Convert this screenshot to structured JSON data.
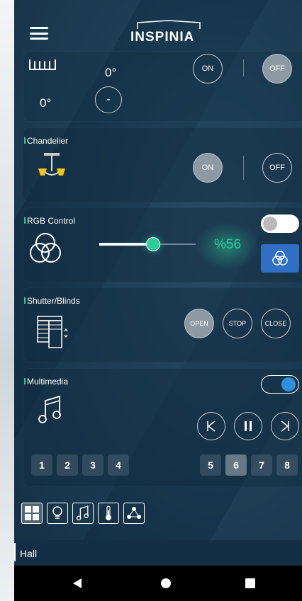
{
  "header": {
    "app_name": "INSPINIA"
  },
  "heating": {
    "setpoint": "0°",
    "current": "0°",
    "minus_label": "-",
    "on_label": "ON",
    "off_label": "OFF"
  },
  "chandelier": {
    "title": "Chandelier",
    "on_label": "ON",
    "off_label": "OFF"
  },
  "rgb": {
    "title": "RGB Control",
    "level_text": "%56",
    "slider_value_percent": 56
  },
  "shutter": {
    "title": "Shutter/Blinds",
    "open_label": "OPEN",
    "stop_label": "STOP",
    "close_label": "CLOSE"
  },
  "multimedia": {
    "title": "Multimedia",
    "numbers": [
      "1",
      "2",
      "3",
      "4",
      "5",
      "6",
      "7",
      "8"
    ],
    "active_number": "6"
  },
  "tabs": [
    "grid-icon",
    "bulb-icon",
    "music-icon",
    "thermometer-icon",
    "network-icon"
  ],
  "room": {
    "label": "Hall"
  },
  "colors": {
    "accent": "#2ecc9a",
    "blue_button": "#2f6fc4",
    "toggle_on": "#2f8fe0"
  }
}
